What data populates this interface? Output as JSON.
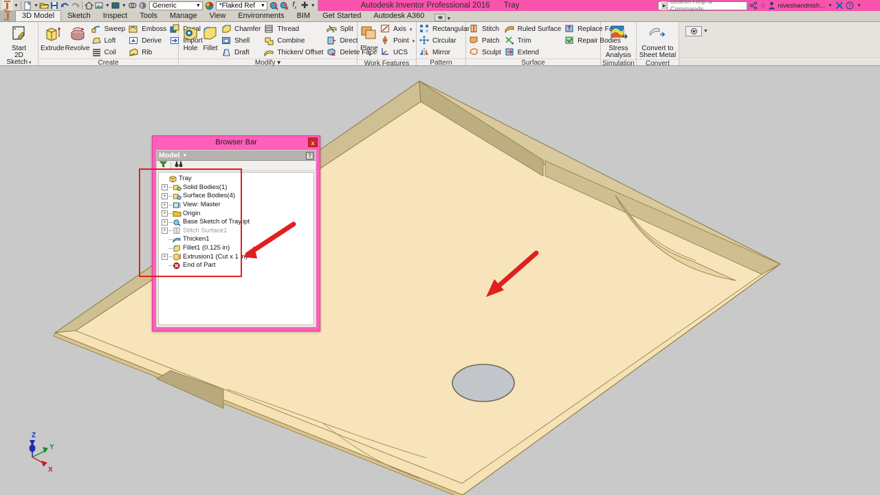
{
  "titlebar": {
    "app_title": "Autodesk Inventor Professional 2016",
    "document_name": "Tray",
    "material_combo": "Generic",
    "appearance_combo": "*Flaked Ref",
    "search_placeholder": "Search Help & Commands...",
    "user_name": "niveshandnish...",
    "quick_access": [
      {
        "name": "new-file",
        "glyph": "⬜"
      },
      {
        "name": "open-file",
        "glyph": "📂"
      },
      {
        "name": "save",
        "glyph": "💾"
      },
      {
        "name": "undo",
        "glyph": "↶"
      },
      {
        "name": "redo",
        "glyph": "↷"
      },
      {
        "name": "home-view",
        "glyph": "⌂"
      },
      {
        "name": "view-face",
        "glyph": "◰"
      },
      {
        "name": "appearance-swatch",
        "glyph": "▣"
      },
      {
        "name": "display-mode",
        "glyph": "◑"
      },
      {
        "name": "shadow-mode",
        "glyph": "●"
      }
    ],
    "right_icons": [
      {
        "name": "share-icon",
        "glyph": "⚷"
      },
      {
        "name": "favorite-star-icon",
        "glyph": "☆"
      },
      {
        "name": "account-icon",
        "glyph": "👤"
      },
      {
        "name": "exchange-icon",
        "glyph": "✖"
      },
      {
        "name": "help-icon",
        "glyph": "?"
      }
    ]
  },
  "tabs": [
    {
      "label": "3D Model",
      "active": true
    },
    {
      "label": "Sketch",
      "active": false
    },
    {
      "label": "Inspect",
      "active": false
    },
    {
      "label": "Tools",
      "active": false
    },
    {
      "label": "Manage",
      "active": false
    },
    {
      "label": "View",
      "active": false
    },
    {
      "label": "Environments",
      "active": false
    },
    {
      "label": "BIM",
      "active": false
    },
    {
      "label": "Get Started",
      "active": false
    },
    {
      "label": "Autodesk A360",
      "active": false
    }
  ],
  "ribbon": {
    "panels": [
      {
        "title": "Sketch",
        "big": [
          {
            "label": "Start\n2D Sketch",
            "icon": "sketch-icon",
            "dropdown": true
          }
        ],
        "small": []
      },
      {
        "title": "Create",
        "big": [
          {
            "label": "Extrude",
            "icon": "extrude-icon"
          },
          {
            "label": "Revolve",
            "icon": "revolve-icon"
          }
        ],
        "small": [
          [
            {
              "label": "Sweep",
              "icon": "sweep-icon"
            },
            {
              "label": "Loft",
              "icon": "loft-icon"
            },
            {
              "label": "Coil",
              "icon": "coil-icon"
            }
          ],
          [
            {
              "label": "Emboss",
              "icon": "emboss-icon"
            },
            {
              "label": "Derive",
              "icon": "derive-icon"
            },
            {
              "label": "Rib",
              "icon": "rib-icon"
            }
          ],
          [
            {
              "label": "Decal",
              "icon": "decal-icon"
            },
            {
              "label": "Import",
              "icon": "import-icon"
            }
          ]
        ]
      },
      {
        "title": "Modify ▾",
        "big": [
          {
            "label": "Hole",
            "icon": "hole-icon"
          },
          {
            "label": "Fillet",
            "icon": "fillet-icon"
          }
        ],
        "small": [
          [
            {
              "label": "Chamfer",
              "icon": "chamfer-icon"
            },
            {
              "label": "Shell",
              "icon": "shell-icon"
            },
            {
              "label": "Draft",
              "icon": "draft-icon"
            }
          ],
          [
            {
              "label": "Thread",
              "icon": "thread-icon"
            },
            {
              "label": "Combine",
              "icon": "combine-icon"
            },
            {
              "label": "Thicken/ Offset",
              "icon": "thicken-icon"
            }
          ],
          [
            {
              "label": "Split",
              "icon": "split-icon"
            },
            {
              "label": "Direct",
              "icon": "direct-icon"
            },
            {
              "label": "Delete Face",
              "icon": "delete-face-icon"
            }
          ]
        ]
      },
      {
        "title": "Work Features",
        "big": [
          {
            "label": "Plane",
            "icon": "plane-icon",
            "dropdown": true
          }
        ],
        "small": [
          [
            {
              "label": "Axis",
              "icon": "axis-icon",
              "arrow": true
            },
            {
              "label": "Point",
              "icon": "point-icon",
              "arrow": true
            },
            {
              "label": "UCS",
              "icon": "ucs-icon"
            }
          ]
        ]
      },
      {
        "title": "Pattern",
        "big": [],
        "small": [
          [
            {
              "label": "Rectangular",
              "icon": "rectangular-pattern-icon"
            },
            {
              "label": "Circular",
              "icon": "circular-pattern-icon"
            },
            {
              "label": "Mirror",
              "icon": "mirror-icon"
            }
          ]
        ]
      },
      {
        "title": "Surface",
        "big": [],
        "small": [
          [
            {
              "label": "Stitch",
              "icon": "stitch-icon"
            },
            {
              "label": "Patch",
              "icon": "patch-icon"
            },
            {
              "label": "Sculpt",
              "icon": "sculpt-icon"
            }
          ],
          [
            {
              "label": "Ruled Surface",
              "icon": "ruled-surface-icon"
            },
            {
              "label": "Trim",
              "icon": "trim-icon"
            },
            {
              "label": "Extend",
              "icon": "extend-icon"
            }
          ],
          [
            {
              "label": "Replace Face",
              "icon": "replace-face-icon"
            },
            {
              "label": "Repair Bodies",
              "icon": "repair-bodies-icon"
            }
          ]
        ]
      },
      {
        "title": "Simulation",
        "big": [
          {
            "label": "Stress\nAnalysis",
            "icon": "stress-analysis-icon"
          }
        ],
        "small": []
      },
      {
        "title": "Convert",
        "big": [
          {
            "label": "Convert to\nSheet Metal",
            "icon": "convert-sheet-metal-icon"
          }
        ],
        "small": []
      }
    ]
  },
  "browser": {
    "title": "Browser Bar",
    "close_label": "x",
    "model_label": "Model",
    "help_label": "?",
    "filter_icon": "filter-icon",
    "find_icon": "find-binoculars-icon",
    "tree": [
      {
        "label": "Tray",
        "icon": "part-icon",
        "depth": 0,
        "expandable": false,
        "dimmed": false
      },
      {
        "label": "Solid Bodies(1)",
        "icon": "solid-bodies-icon",
        "depth": 1,
        "expandable": true,
        "dimmed": false
      },
      {
        "label": "Surface Bodies(4)",
        "icon": "surface-bodies-icon",
        "depth": 1,
        "expandable": true,
        "dimmed": false
      },
      {
        "label": "View: Master",
        "icon": "view-master-icon",
        "depth": 1,
        "expandable": true,
        "dimmed": false
      },
      {
        "label": "Origin",
        "icon": "origin-folder-icon",
        "depth": 1,
        "expandable": true,
        "dimmed": false
      },
      {
        "label": "Base Sketch of Tray.ipt",
        "icon": "sketch-feature-icon",
        "depth": 1,
        "expandable": true,
        "dimmed": false
      },
      {
        "label": "Stitch Surface1",
        "icon": "stitch-surface-icon",
        "depth": 1,
        "expandable": true,
        "dimmed": true
      },
      {
        "label": "Thicken1",
        "icon": "thicken-feature-icon",
        "depth": 1,
        "expandable": false,
        "dimmed": false
      },
      {
        "label": "Fillet1 (0.125 in)",
        "icon": "fillet-feature-icon",
        "depth": 1,
        "expandable": false,
        "dimmed": false
      },
      {
        "label": "Extrusion1 (Cut x 1 in)",
        "icon": "extrusion-feature-icon",
        "depth": 1,
        "expandable": true,
        "dimmed": false
      },
      {
        "label": "End of Part",
        "icon": "end-of-part-icon",
        "depth": 1,
        "expandable": false,
        "dimmed": false
      }
    ]
  },
  "viewport": {
    "axis_labels": {
      "z": "Z",
      "y": "Y",
      "x": "X"
    },
    "model_name": "Tray"
  },
  "colors": {
    "title_bar_pink": "#f953ad",
    "browser_panel_pink": "#ff5fbb",
    "annotation_red": "#e02020",
    "canvas_gray": "#c9c9c9",
    "model_tan": "#f5dfb2",
    "model_tan_shaded": "#c9bb94",
    "hole_gray": "#c2c6cb",
    "axis_z_blue": "#1a2fb0",
    "axis_y_green": "#1f8a2f",
    "axis_x_red": "#c81e1e"
  }
}
